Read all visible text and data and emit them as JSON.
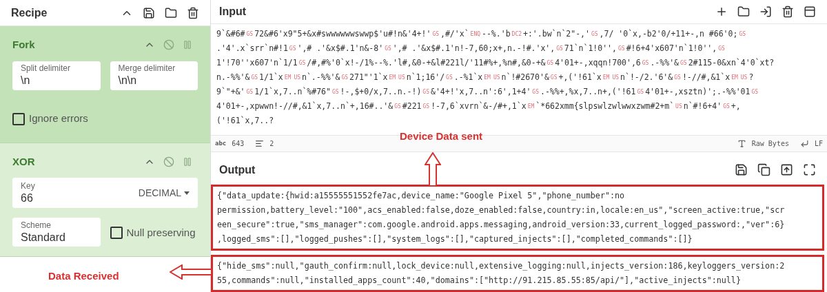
{
  "recipe": {
    "title": "Recipe",
    "operations": [
      {
        "name": "Fork",
        "highlighted": true,
        "args": [
          {
            "kind": "field",
            "label": "Split delimiter",
            "value": "\\n"
          },
          {
            "kind": "field",
            "label": "Merge delimiter",
            "value": "\\n\\n"
          },
          {
            "kind": "checkbox",
            "label": "Ignore errors",
            "checked": false
          }
        ]
      },
      {
        "name": "XOR",
        "highlighted": false,
        "args": [
          {
            "kind": "select-field",
            "label": "Key",
            "value": "66",
            "option": "DECIMAL"
          },
          {
            "kind": "field",
            "label": "Scheme",
            "value": "Standard"
          },
          {
            "kind": "checkbox",
            "label": "Null preserving",
            "checked": false
          }
        ]
      }
    ]
  },
  "input": {
    "title": "Input",
    "lines": [
      [
        {
          "kind": "text",
          "text": "9`&#6#"
        },
        {
          "kind": "control",
          "text": "GS"
        },
        {
          "kind": "text",
          "text": "72&#6'x9\"5+&x#swwwwwwswwp$'u#!n&'4+!'"
        },
        {
          "kind": "control",
          "text": "GS"
        },
        {
          "kind": "text",
          "text": ",#/'x`"
        },
        {
          "kind": "control",
          "text": "ENQ"
        },
        {
          "kind": "text",
          "text": "--%.'b"
        },
        {
          "kind": "control",
          "text": "DC2"
        },
        {
          "kind": "text",
          "text": "+:'.bw`n`2\"-,'"
        },
        {
          "kind": "control",
          "text": "GS"
        },
        {
          "kind": "text",
          "text": ",7/ '0`x,-b2'0/+11+-,n #66'0;"
        },
        {
          "kind": "control",
          "text": "GS"
        }
      ],
      [
        {
          "kind": "text",
          "text": ".'4'.x`srr`n#!1"
        },
        {
          "kind": "control",
          "text": "GS"
        },
        {
          "kind": "text",
          "text": "',# .'&x$#.1'n&-8'"
        },
        {
          "kind": "control",
          "text": "GS"
        },
        {
          "kind": "text",
          "text": "',# .'&x$#.1'n!-7,60;x+,n.-!#.'x',"
        },
        {
          "kind": "control",
          "text": "GS"
        },
        {
          "kind": "text",
          "text": "71`n`1!0'',"
        },
        {
          "kind": "control",
          "text": "GS"
        },
        {
          "kind": "text",
          "text": "#!6+4'x607'n`1!0'',"
        },
        {
          "kind": "control",
          "text": "GS"
        }
      ],
      [
        {
          "kind": "text",
          "text": "1'!70''x607'n`1/1"
        },
        {
          "kind": "control",
          "text": "GS"
        },
        {
          "kind": "text",
          "text": "/#,#%'0`x!-/1%--%.'l#,&0-+&l#221l/'11#%+,%n#,&0-+&"
        },
        {
          "kind": "control",
          "text": "GS"
        },
        {
          "kind": "text",
          "text": "4'01+-,xqqn!700',6"
        },
        {
          "kind": "control",
          "text": "GS"
        },
        {
          "kind": "text",
          "text": ".-%%'&"
        },
        {
          "kind": "control",
          "text": "GS"
        },
        {
          "kind": "text",
          "text": "2#115-0&xn`4'0`xt?"
        }
      ],
      [
        {
          "kind": "text",
          "text": "n.-%%'&"
        },
        {
          "kind": "control",
          "text": "GS"
        },
        {
          "kind": "text",
          "text": "1/1`x"
        },
        {
          "kind": "control",
          "text": "EM"
        },
        {
          "kind": "control",
          "text": "US"
        },
        {
          "kind": "text",
          "text": "n`.-%%'&"
        },
        {
          "kind": "control",
          "text": "GS"
        },
        {
          "kind": "text",
          "text": "271\"'1`x"
        },
        {
          "kind": "control",
          "text": "EM"
        },
        {
          "kind": "control",
          "text": "US"
        },
        {
          "kind": "text",
          "text": "n`1;16'/"
        },
        {
          "kind": "control",
          "text": "GS"
        },
        {
          "kind": "text",
          "text": ".-%1`x"
        },
        {
          "kind": "control",
          "text": "EM"
        },
        {
          "kind": "control",
          "text": "US"
        },
        {
          "kind": "text",
          "text": "n`!#2670'&"
        },
        {
          "kind": "control",
          "text": "GS"
        },
        {
          "kind": "text",
          "text": "+,('!61`x"
        },
        {
          "kind": "control",
          "text": "EM"
        },
        {
          "kind": "control",
          "text": "US"
        },
        {
          "kind": "text",
          "text": "n`!-/2.'6'&"
        },
        {
          "kind": "control",
          "text": "GS"
        },
        {
          "kind": "text",
          "text": "!-//#,&1`x"
        },
        {
          "kind": "control",
          "text": "EM"
        },
        {
          "kind": "control",
          "text": "US"
        },
        {
          "kind": "text",
          "text": "?"
        }
      ],
      [
        {
          "kind": "text",
          "text": "9`\"+&'"
        },
        {
          "kind": "control",
          "text": "GS"
        },
        {
          "kind": "text",
          "text": "1/1`x,7..n`%#76\""
        },
        {
          "kind": "control",
          "text": "GS"
        },
        {
          "kind": "text",
          "text": "!-,$+0/x,7..n.-!)"
        },
        {
          "kind": "control",
          "text": "GS"
        },
        {
          "kind": "text",
          "text": "&'4+!'x,7..n':6',1+4'"
        },
        {
          "kind": "control",
          "text": "GS"
        },
        {
          "kind": "text",
          "text": ".-%%+,%x,7..n+,('!61"
        },
        {
          "kind": "control",
          "text": "GS"
        },
        {
          "kind": "text",
          "text": "4'01+-,xsztn)';.-%%'01"
        },
        {
          "kind": "control",
          "text": "GS"
        }
      ],
      [
        {
          "kind": "text",
          "text": "4'01+-,xpwwn!-//#,&1`x,7..n`+,16#..'&"
        },
        {
          "kind": "control",
          "text": "GS"
        },
        {
          "kind": "text",
          "text": "#221"
        },
        {
          "kind": "control",
          "text": "GS"
        },
        {
          "kind": "text",
          "text": "!-7,6`xvrn`&-/#+,1`x"
        },
        {
          "kind": "control",
          "text": "EM"
        },
        {
          "kind": "text",
          "text": "`*662xmm{slpswlzwlwwxzwm#2+m`"
        },
        {
          "kind": "control",
          "text": "US"
        },
        {
          "kind": "text",
          "text": "n`#!6+4'"
        },
        {
          "kind": "control",
          "text": "GS"
        },
        {
          "kind": "text",
          "text": "+,"
        }
      ],
      [
        {
          "kind": "text",
          "text": "('!61`x,7..?"
        }
      ]
    ],
    "status": {
      "length_label": "abc",
      "length": "643",
      "lines": "2",
      "encoding": "Raw Bytes",
      "eol": "LF"
    }
  },
  "output": {
    "title": "Output",
    "blocks": [
      {
        "lines": [
          "{\"data_update:{hwid:a15555551552fe7ac,device_name:\"Google Pixel 5\",\"phone_number\":no",
          "permission,battery_level:\"100\",acs_enabled:false,doze_enabled:false,country:in,locale:en_us\",\"screen_active:true,\"scr",
          "een_secure\":true,\"sms_manager\":com.google.android.apps.messaging,android_version:33,current_logged_password:,\"ver\":6}",
          ",logged_sms\":[],\"logged_pushes\":[],\"system_logs\":[],\"captured_injects\":[],\"completed_commands\":[]}"
        ]
      },
      {
        "lines": [
          "{\"hide_sms\":null,\"gauth_confirm:null,lock_device:null,extensive_logging:null,injects_version:186,keyloggers_version:2",
          "55,commands\":null,\"installed_apps_count\":40,\"domains\":[\"http://91.215.85.55:85/api/\"],\"active_injects\":null}"
        ]
      }
    ]
  },
  "annotations": [
    {
      "kind": "up-arrow",
      "text": "Device Data sent"
    },
    {
      "kind": "left-arrow",
      "text": "Data Received"
    }
  ]
}
